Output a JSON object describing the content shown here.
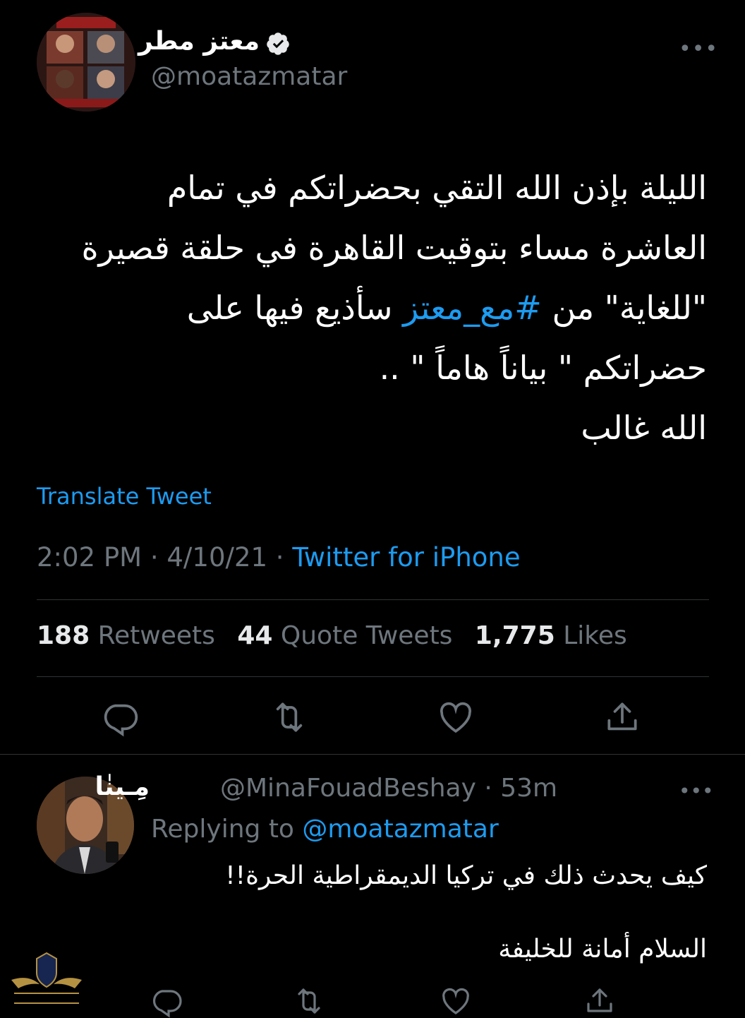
{
  "tweet": {
    "author": {
      "display_name": "معتز مطر",
      "handle": "@moatazmatar",
      "verified": true,
      "avatar_icon": "avatar-collage"
    },
    "text_lines": [
      "الليلة بإذن الله التقي بحضراتكم في تمام",
      "العاشرة مساء بتوقيت القاهرة في حلقة قصيرة",
      "\"للغاية\"  من ",
      "#مع_معتز",
      " سأذيع فيها على",
      "حضراتكم \" بياناً هاماً \" ..",
      "الله غالب"
    ],
    "translate_label": "Translate Tweet",
    "time": "2:02 PM",
    "separator": "·",
    "date": "4/10/21",
    "source": "Twitter for iPhone",
    "stats": {
      "retweets_count": "188",
      "retweets_label": "Retweets",
      "quotes_count": "44",
      "quotes_label": "Quote Tweets",
      "likes_count": "1,775",
      "likes_label": "Likes"
    },
    "more_icon": "more-icon"
  },
  "reply": {
    "display_name": "مِـينٰا",
    "handle": "@MinaFouadBeshay",
    "time_ago": "· 53m",
    "replying_label": "Replying to",
    "replying_to": "@moatazmatar",
    "text_line_1": "كيف يحدث ذلك في تركيا الديمقراطية الحرة!!",
    "text_line_2": "السلام أمانة للخليفة"
  },
  "colors": {
    "background": "#000000",
    "text": "#e7e9ea",
    "muted": "#6e767d",
    "accent": "#1d9bf0",
    "divider": "#2f3336"
  },
  "icons": [
    "reply-icon",
    "retweet-icon",
    "like-icon",
    "share-icon",
    "verified-badge-icon",
    "more-icon"
  ]
}
